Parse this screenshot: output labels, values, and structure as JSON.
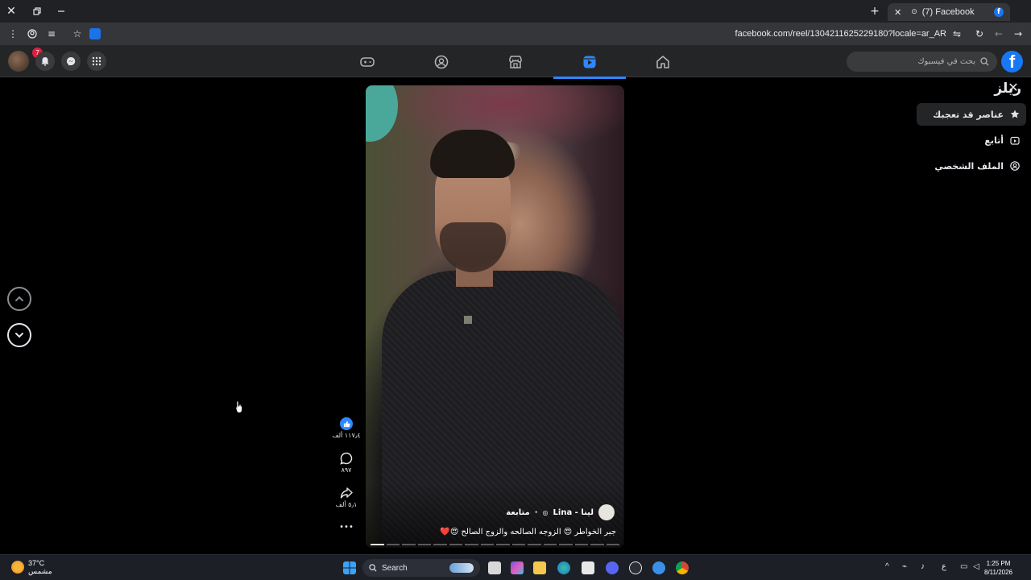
{
  "browser": {
    "tab_title": "(7) Facebook",
    "tab_favicon": "f",
    "url": "facebook.com/reel/1304211625229180?locale=ar_AR"
  },
  "fb": {
    "logo": "f",
    "search_placeholder": "بحث في فيسبوك",
    "notification_count": "7",
    "nav": [
      "gaming-icon",
      "groups-icon",
      "marketplace-icon",
      "reels-icon",
      "home-icon"
    ],
    "active_nav": "reels-icon",
    "accent": "#2d88ff"
  },
  "sidebar": {
    "title": "ريلز",
    "items": [
      {
        "label": "عناصر قد تعجبك",
        "icon": "star-icon",
        "selected": true
      },
      {
        "label": "أتابع",
        "icon": "following-icon",
        "selected": false
      },
      {
        "label": "الملف الشخصي",
        "icon": "profile-icon",
        "selected": false
      }
    ]
  },
  "reel": {
    "author_name": "لينا - Lina",
    "follow_label": "متابعة",
    "caption": "جبر الخواطر 😍 الزوجه الصالحه والزوج الصالح 😍❤️",
    "likes": "١١٧٫٤ ألف",
    "comments": "٨٩٧",
    "shares": "٥٫١ ألف",
    "more": "•••"
  },
  "taskbar": {
    "temperature": "37°C",
    "weather_text": "مشمس",
    "search_label": "Search",
    "time": "1:25 PM",
    "date": "8/11/2026",
    "lang": "ع"
  }
}
